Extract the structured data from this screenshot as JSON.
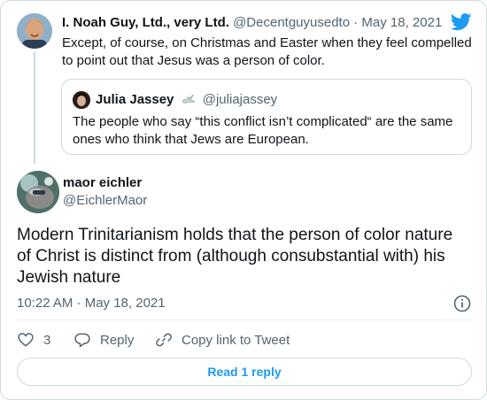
{
  "parent_tweet": {
    "display_name": "I. Noah Guy, Ltd., very Ltd.",
    "handle": "@Decentguyusedto",
    "separator": "·",
    "date": "May 18, 2021",
    "text": "Except, of course, on Christmas and Easter when they feel compelled to point out that Jesus was a person of color."
  },
  "quoted_tweet": {
    "display_name": "Julia Jassey",
    "handle": "@juliajassey",
    "text": "The people who say “this conflict isn’t complicated“ are the same ones who think that Jews are European."
  },
  "main_tweet": {
    "display_name": "maor eichler",
    "handle": "@EichlerMaor",
    "text": "Modern Trinitarianism holds that the person of color nature of Christ is distinct from (although consubstantial with) his Jewish nature",
    "timestamp": "10:22 AM · May 18, 2021"
  },
  "actions": {
    "like_count": "3",
    "reply_label": "Reply",
    "copy_link_label": "Copy link to Tweet"
  },
  "read_replies_label": "Read 1 reply",
  "colors": {
    "brand_blue": "#1d9bf0",
    "secondary_text": "#536471",
    "border": "#cfd9de"
  },
  "icons": {
    "logo": "twitter-bird-icon",
    "info": "info-icon",
    "like": "heart-icon",
    "reply": "reply-bubble-icon",
    "copy_link": "link-icon",
    "quote_decoration": "dove-icon"
  }
}
